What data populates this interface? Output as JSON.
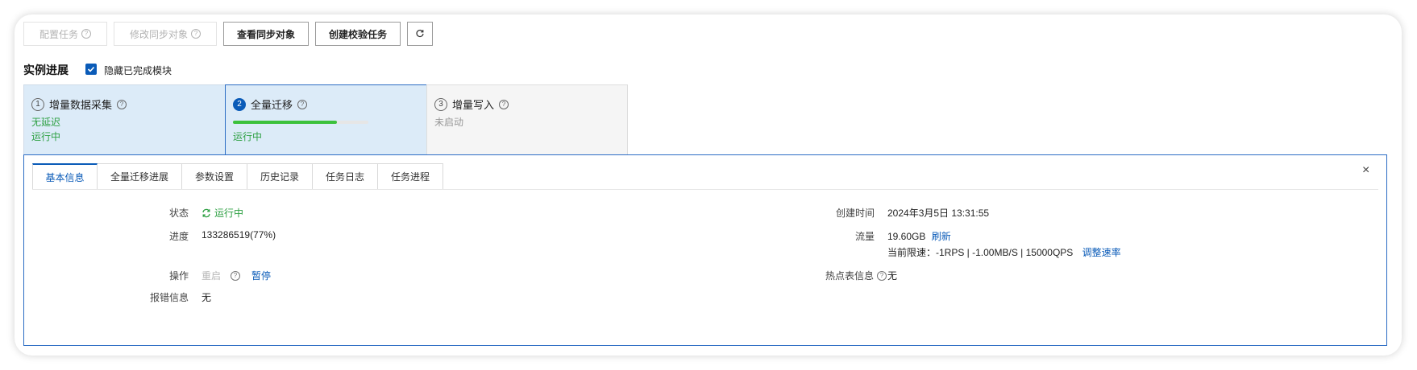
{
  "toolbar": {
    "configure_task": "配置任务",
    "modify_sync_objects": "修改同步对象",
    "view_sync_objects": "查看同步对象",
    "create_check_task": "创建校验任务",
    "refresh_icon": "refresh-icon"
  },
  "progress_section": {
    "title": "实例进展",
    "hide_completed_label": "隐藏已完成模块",
    "hide_completed_checked": true
  },
  "steps": [
    {
      "number": "1",
      "title": "增量数据采集",
      "line1": "无延迟",
      "line2": "运行中"
    },
    {
      "number": "2",
      "title": "全量迁移",
      "progress": 0.77,
      "line2": "运行中"
    },
    {
      "number": "3",
      "title": "增量写入",
      "line1": "未启动"
    }
  ],
  "tabs": [
    "基本信息",
    "全量迁移进展",
    "参数设置",
    "历史记录",
    "任务日志",
    "任务进程"
  ],
  "basic_info": {
    "status_label": "状态",
    "status_value": "运行中",
    "progress_label": "进度",
    "progress_value": "133286519(77%)",
    "operation_label": "操作",
    "restart": "重启",
    "pause": "暂停",
    "error_label": "报错信息",
    "error_value": "无",
    "created_label": "创建时间",
    "created_value": "2024年3月5日 13:31:55",
    "traffic_label": "流量",
    "traffic_value": "19.60GB",
    "refresh": "刷新",
    "rate_limit": "当前限速：-1RPS | -1.00MB/S | 15000QPS",
    "adjust_rate": "调整速率",
    "hotspot_label": "热点表信息",
    "hotspot_value": "无"
  },
  "colors": {
    "accent": "#0a5bb8",
    "running_green": "#2ea043",
    "active_step_bg": "#dcebf8",
    "inactive_step_bg": "#f5f5f5"
  }
}
